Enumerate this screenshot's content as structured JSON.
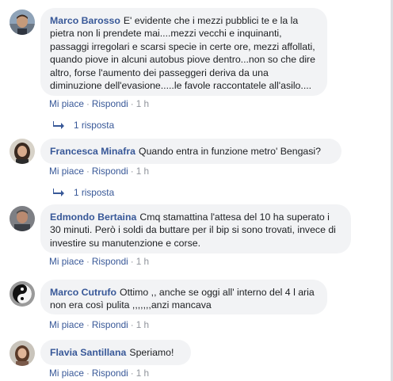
{
  "comments": [
    {
      "author": "Marco Barosso",
      "text": "E' evidente che i mezzi pubblici te e la la pietra non li prendete mai....mezzi vecchi e inquinanti, passaggi irregolari e scarsi specie in certe ore, mezzi affollati, quando piove in alcuni autobus piove dentro...non so che dire altro, forse l'aumento dei passeggeri deriva da una diminuzione dell'evasione.....le favole raccontatele all'asilo....",
      "like_label": "Mi piace",
      "reply_label": "Rispondi",
      "time": "1 h",
      "replies_label": "1 risposta"
    },
    {
      "author": "Francesca Minafra",
      "text": "Quando entra in funzione metro' Bengasi?",
      "like_label": "Mi piace",
      "reply_label": "Rispondi",
      "time": "1 h",
      "replies_label": "1 risposta"
    },
    {
      "author": "Edmondo Bertaina",
      "text": "Cmq stamattina l'attesa del 10 ha superato i 30 minuti. Però i soldi da buttare per il bip si sono trovati, invece di investire su manutenzione e corse.",
      "like_label": "Mi piace",
      "reply_label": "Rispondi",
      "time": "1 h"
    },
    {
      "author": "Marco Cutrufo",
      "text": "Ottimo ,, anche se oggi all' interno del 4 l aria non era così pulita ,,,,,,,anzi mancava",
      "like_label": "Mi piace",
      "reply_label": "Rispondi",
      "time": "1 h"
    },
    {
      "author": "Flavia Santillana",
      "text": "Speriamo!",
      "like_label": "Mi piace",
      "reply_label": "Rispondi",
      "time": "1 h"
    }
  ],
  "separator": "·"
}
